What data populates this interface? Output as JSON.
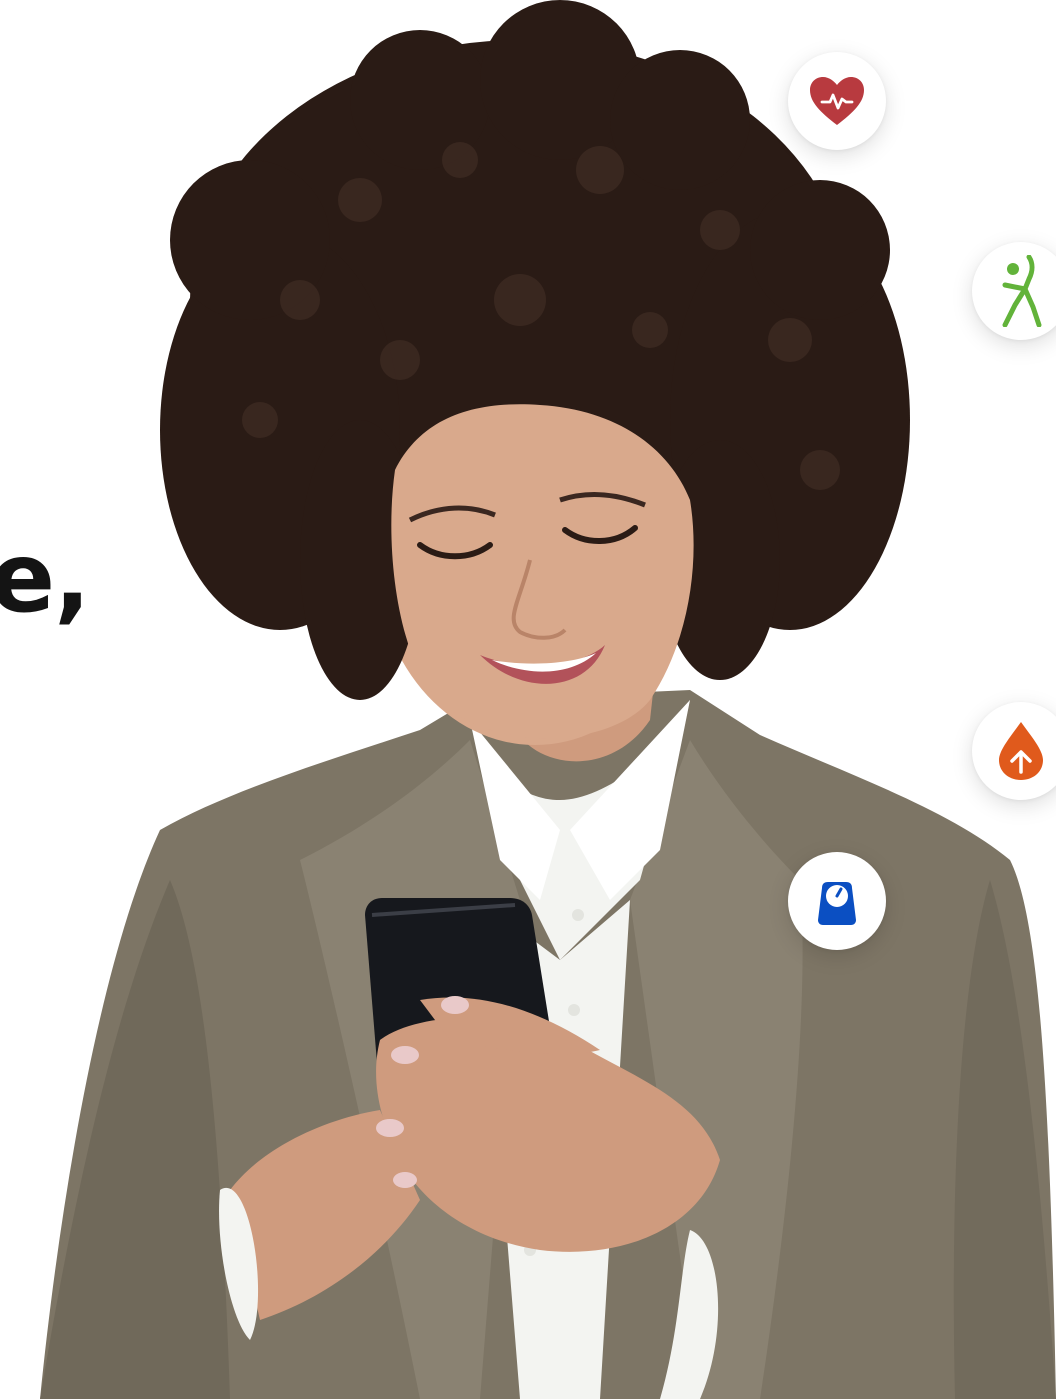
{
  "headline": {
    "fragment": "e,"
  },
  "badges": [
    {
      "icon": "heart-rate-icon",
      "color": "#b83a3f"
    },
    {
      "icon": "stretching-person-icon",
      "color": "#62b33a"
    },
    {
      "icon": "blood-sugar-up-icon",
      "color": "#e05a1c"
    },
    {
      "icon": "weight-scale-icon",
      "color": "#0b4fc2"
    }
  ],
  "colors": {
    "jacket": "#7d7565",
    "shirt": "#f3f4f1",
    "hair": "#2a1b15",
    "skin": "#d9a98c",
    "phone": "#16181d"
  }
}
